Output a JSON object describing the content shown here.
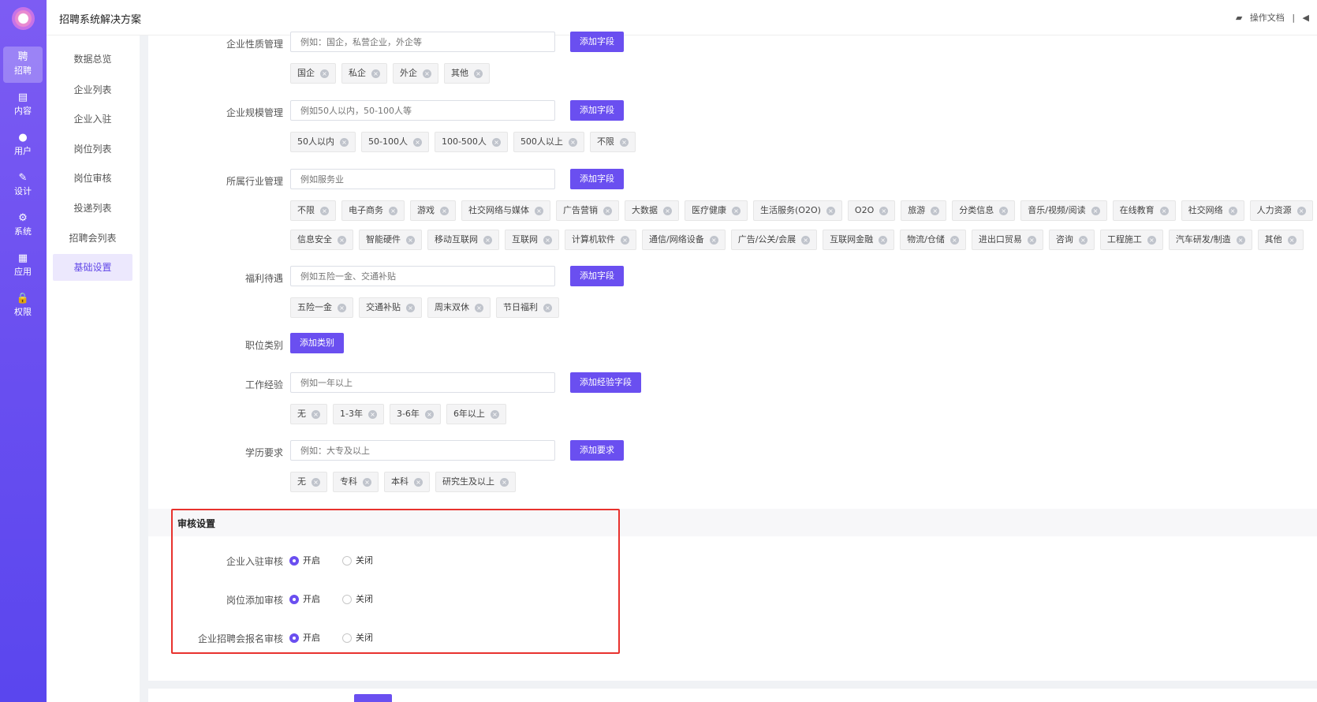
{
  "app_title": "招聘系统解决方案",
  "top_right": {
    "docs": "操作文档"
  },
  "rail": [
    {
      "icon": "聘",
      "label": "招聘"
    },
    {
      "icon": "▤",
      "label": "内容"
    },
    {
      "icon": "●",
      "label": "用户"
    },
    {
      "icon": "✎",
      "label": "设计"
    },
    {
      "icon": "⚙",
      "label": "系统"
    },
    {
      "icon": "▦",
      "label": "应用"
    },
    {
      "icon": "🔒",
      "label": "权限"
    }
  ],
  "subnav": [
    "数据总览",
    "企业列表",
    "企业入驻",
    "岗位列表",
    "岗位审核",
    "投递列表",
    "招聘会列表",
    "基础设置"
  ],
  "fields": {
    "nature": {
      "label": "企业性质管理",
      "placeholder": "例如：国企，私营企业，外企等",
      "button": "添加字段",
      "tags": [
        "国企",
        "私企",
        "外企",
        "其他"
      ]
    },
    "scale": {
      "label": "企业规模管理",
      "placeholder": "例如50人以内，50-100人等",
      "button": "添加字段",
      "tags": [
        "50人以内",
        "50-100人",
        "100-500人",
        "500人以上",
        "不限"
      ]
    },
    "industry": {
      "label": "所属行业管理",
      "placeholder": "例如服务业",
      "button": "添加字段",
      "tags_row1": [
        "不限",
        "电子商务",
        "游戏",
        "社交网络与媒体",
        "广告营销",
        "大数据",
        "医疗健康",
        "生活服务(O2O)",
        "O2O",
        "旅游",
        "分类信息",
        "音乐/视频/阅读",
        "在线教育",
        "社交网络",
        "人力资源"
      ],
      "tags_row2": [
        "信息安全",
        "智能硬件",
        "移动互联网",
        "互联网",
        "计算机软件",
        "通信/网络设备",
        "广告/公关/会展",
        "互联网金融",
        "物流/仓储",
        "进出口贸易",
        "咨询",
        "工程施工",
        "汽车研发/制造",
        "其他"
      ]
    },
    "welfare": {
      "label": "福利待遇",
      "placeholder": "例如五险一金、交通补贴",
      "button": "添加字段",
      "tags": [
        "五险一金",
        "交通补贴",
        "周末双休",
        "节日福利"
      ]
    },
    "category": {
      "label": "职位类别",
      "button": "添加类别"
    },
    "experience": {
      "label": "工作经验",
      "placeholder": "例如一年以上",
      "button": "添加经验字段",
      "tags": [
        "无",
        "1-3年",
        "3-6年",
        "6年以上"
      ]
    },
    "education": {
      "label": "学历要求",
      "placeholder": "例如：大专及以上",
      "button": "添加要求",
      "tags": [
        "无",
        "专科",
        "本科",
        "研究生及以上"
      ]
    }
  },
  "review": {
    "title": "审核设置",
    "rows": [
      {
        "label": "企业入驻审核",
        "on": "开启",
        "off": "关闭",
        "selected": "开启"
      },
      {
        "label": "岗位添加审核",
        "on": "开启",
        "off": "关闭",
        "selected": "开启"
      },
      {
        "label": "企业招聘会报名审核",
        "on": "开启",
        "off": "关闭",
        "selected": "开启"
      }
    ]
  },
  "colors": {
    "accent": "#6a4ff0",
    "highlight_border": "#e8322e"
  }
}
